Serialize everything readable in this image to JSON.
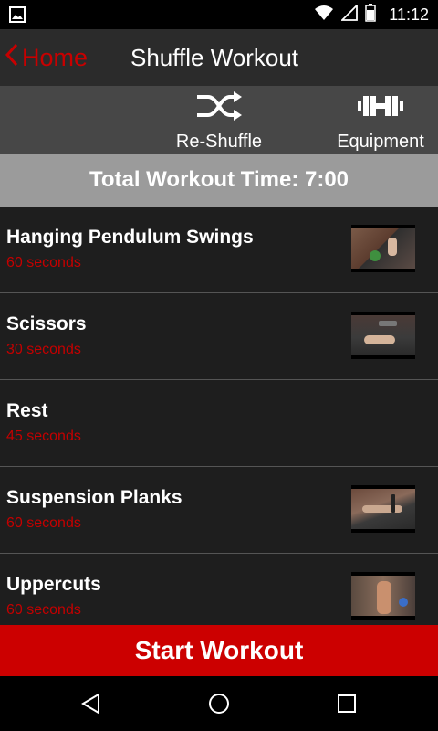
{
  "status_bar": {
    "time": "11:12",
    "icons": [
      "image-icon",
      "wifi-icon",
      "signal-icon",
      "battery-icon"
    ]
  },
  "action_bar": {
    "back_label": "Home",
    "title": "Shuffle Workout"
  },
  "toolbar": {
    "reshuffle_label": "Re-Shuffle",
    "equipment_label": "Equipment"
  },
  "total_time": "Total Workout Time: 7:00",
  "exercises": [
    {
      "name": "Hanging Pendulum Swings",
      "duration": "60 seconds"
    },
    {
      "name": "Scissors",
      "duration": "30 seconds"
    },
    {
      "name": "Rest",
      "duration": "45 seconds"
    },
    {
      "name": "Suspension Planks",
      "duration": "60 seconds"
    },
    {
      "name": "Uppercuts",
      "duration": "60 seconds"
    }
  ],
  "start_button": "Start Workout",
  "colors": {
    "accent": "#cc0000",
    "duration_text": "#c40000",
    "action_bar": "#2b2b2b",
    "toolbar": "#474747",
    "total_bar": "#9b9b9b",
    "list_bg": "#1e1e1e"
  }
}
